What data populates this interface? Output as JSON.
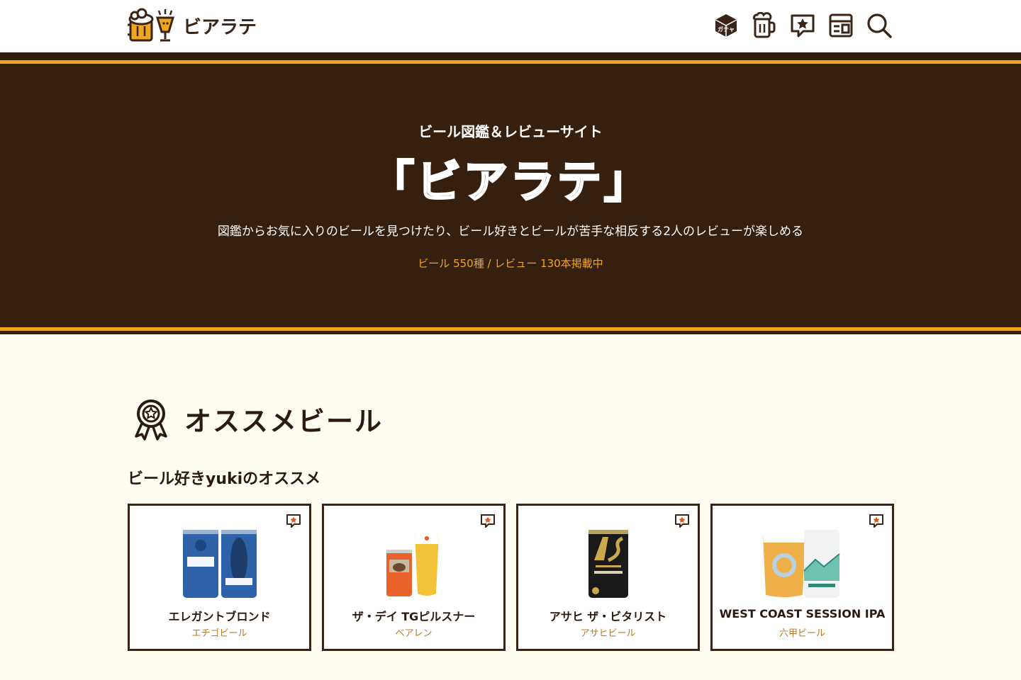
{
  "header": {
    "logo_text": "ビアラテ",
    "nav": [
      {
        "icon": "gacha-icon",
        "label": "ガチャ"
      },
      {
        "icon": "beer-mug-icon"
      },
      {
        "icon": "review-icon"
      },
      {
        "icon": "layout-icon"
      },
      {
        "icon": "search-icon"
      }
    ]
  },
  "hero": {
    "subtitle": "ビール図鑑＆レビューサイト",
    "title": "「ビアラテ」",
    "description": "図鑑からお気に入りのビールを見つけたり、ビール好きとビールが苦手な相反する2人のレビューが楽しめる",
    "stats": "ビール 550種 / レビュー 130本掲載中"
  },
  "recommend": {
    "title": "オススメビール",
    "subtitle": "ビール好きyukiのオススメ",
    "cards": [
      {
        "name": "エレガントブロンド",
        "maker": "エチゴビール"
      },
      {
        "name": "ザ・デイ TGピルスナー",
        "maker": "ベアレン"
      },
      {
        "name": "アサヒ ザ・ビタリスト",
        "maker": "アサヒビール"
      },
      {
        "name": "WEST COAST SESSION IPA",
        "maker": "六甲ビール"
      }
    ]
  },
  "colors": {
    "brown": "#35200f",
    "gold": "#f0a520",
    "cream": "#fffdf2"
  }
}
